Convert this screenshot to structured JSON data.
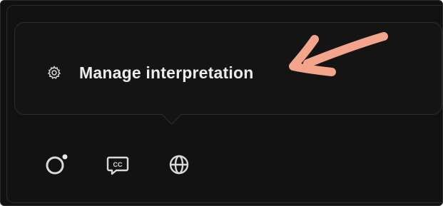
{
  "popover": {
    "menu_item": {
      "icon": "gear-icon",
      "label": "Manage interpretation"
    }
  },
  "annotation": {
    "icon": "arrow-pointer-icon",
    "color": "#f4a48a"
  },
  "toolbar": {
    "buttons": [
      {
        "icon": "record-status-icon",
        "name": "status"
      },
      {
        "icon": "closed-captions-icon",
        "name": "captions"
      },
      {
        "icon": "globe-icon",
        "name": "language"
      }
    ]
  },
  "colors": {
    "background": "#111111",
    "text": "#ececec",
    "border": "#2e2e2e"
  }
}
